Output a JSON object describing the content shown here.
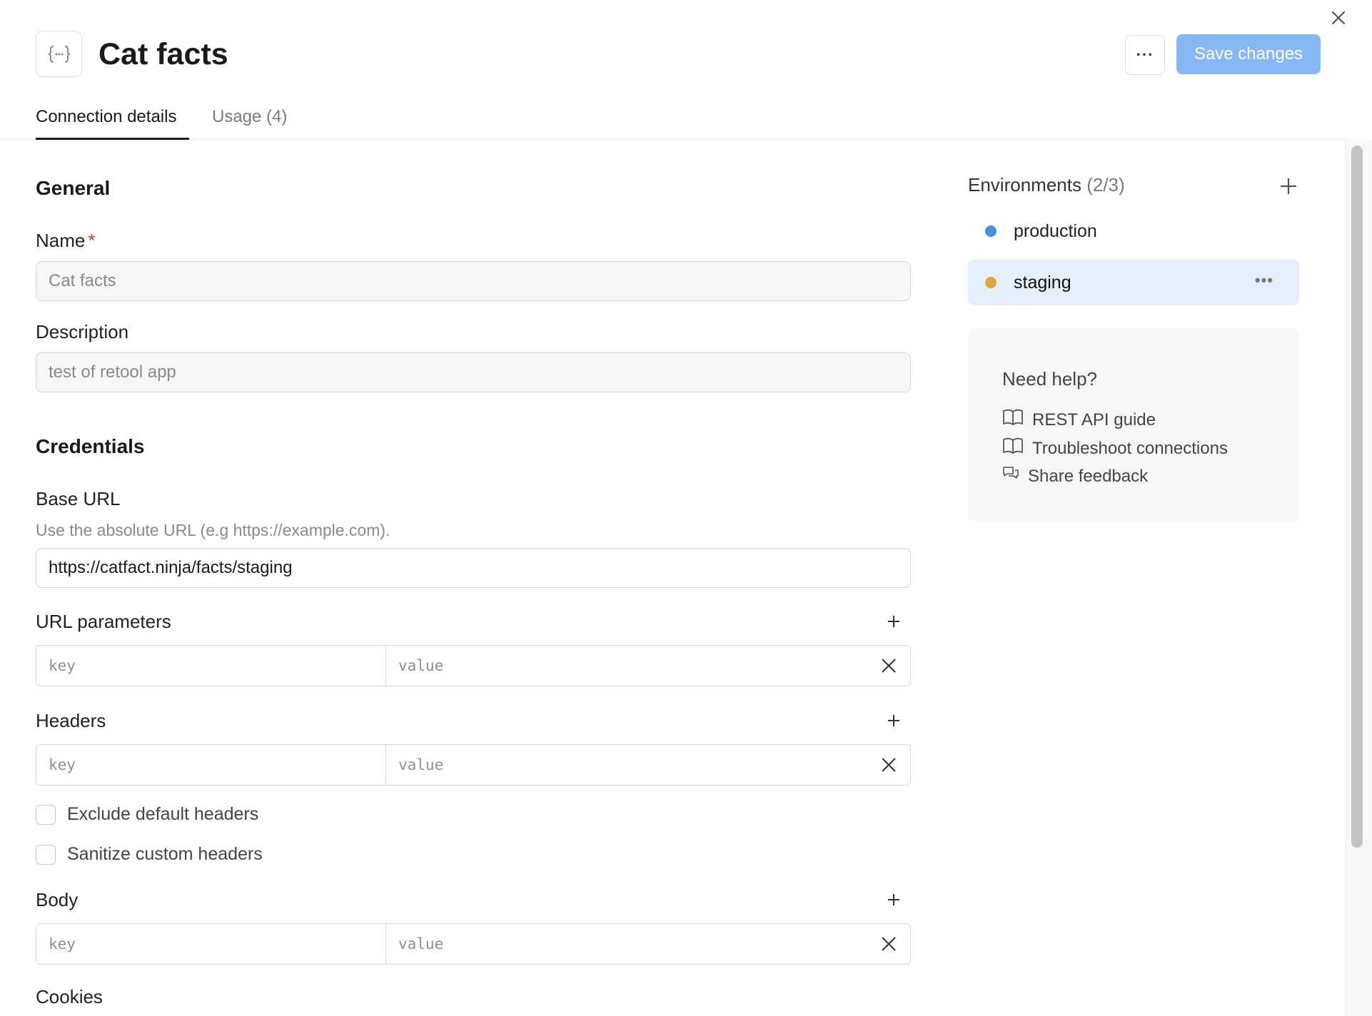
{
  "header": {
    "title": "Cat facts",
    "more_label": "···",
    "save_label": "Save changes"
  },
  "tabs": [
    {
      "label": "Connection details",
      "active": true
    },
    {
      "label": "Usage  (4)",
      "active": false
    }
  ],
  "general": {
    "section_title": "General",
    "name_label": "Name",
    "name_required": "*",
    "name_value": "Cat facts",
    "description_label": "Description",
    "description_value": "test of retool app"
  },
  "credentials": {
    "section_title": "Credentials",
    "base_url_label": "Base URL",
    "base_url_hint": "Use the absolute URL (e.g https://example.com).",
    "base_url_value": "https://catfact.ninja/facts/staging",
    "url_params_label": "URL parameters",
    "headers_label": "Headers",
    "body_label": "Body",
    "cookies_label": "Cookies",
    "key_placeholder": "key",
    "value_placeholder": "value",
    "exclude_default_headers": "Exclude default headers",
    "sanitize_custom_headers": "Sanitize custom headers"
  },
  "environments": {
    "title": "Environments",
    "count": "(2/3)",
    "items": [
      {
        "name": "production",
        "color": "#4a8fdb",
        "selected": false
      },
      {
        "name": "staging",
        "color": "#e0a63c",
        "selected": true
      }
    ],
    "item_more": "•••"
  },
  "help": {
    "title": "Need help?",
    "links": [
      {
        "label": "REST API guide",
        "icon": "book-icon"
      },
      {
        "label": "Troubleshoot connections",
        "icon": "book-icon"
      },
      {
        "label": "Share feedback",
        "icon": "chat-icon"
      }
    ]
  },
  "colors": {
    "accent": "#87b7f5",
    "selected_bg": "#e6f0fd",
    "required": "#c43b2b"
  }
}
